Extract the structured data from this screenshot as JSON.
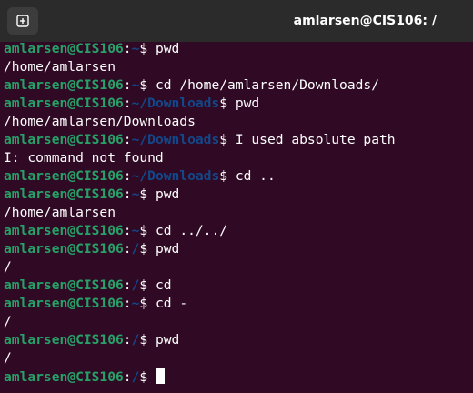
{
  "window": {
    "title": "amlarsen@CIS106: /"
  },
  "terminal": {
    "lines": [
      {
        "type": "prompt",
        "user": "amlarsen@CIS106",
        "path": "~",
        "command": "pwd"
      },
      {
        "type": "output",
        "text": "/home/amlarsen"
      },
      {
        "type": "prompt",
        "user": "amlarsen@CIS106",
        "path": "~",
        "command": "cd /home/amlarsen/Downloads/"
      },
      {
        "type": "prompt",
        "user": "amlarsen@CIS106",
        "path": "~/Downloads",
        "command": "pwd"
      },
      {
        "type": "output",
        "text": "/home/amlarsen/Downloads"
      },
      {
        "type": "prompt",
        "user": "amlarsen@CIS106",
        "path": "~/Downloads",
        "command": "I used absolute path"
      },
      {
        "type": "output",
        "text": "I: command not found"
      },
      {
        "type": "prompt",
        "user": "amlarsen@CIS106",
        "path": "~/Downloads",
        "command": "cd .."
      },
      {
        "type": "prompt",
        "user": "amlarsen@CIS106",
        "path": "~",
        "command": "pwd"
      },
      {
        "type": "output",
        "text": "/home/amlarsen"
      },
      {
        "type": "prompt",
        "user": "amlarsen@CIS106",
        "path": "~",
        "command": "cd ../../"
      },
      {
        "type": "prompt",
        "user": "amlarsen@CIS106",
        "path": "/",
        "command": "pwd"
      },
      {
        "type": "output",
        "text": "/"
      },
      {
        "type": "prompt",
        "user": "amlarsen@CIS106",
        "path": "/",
        "command": "cd"
      },
      {
        "type": "prompt",
        "user": "amlarsen@CIS106",
        "path": "~",
        "command": "cd -"
      },
      {
        "type": "output",
        "text": "/"
      },
      {
        "type": "prompt",
        "user": "amlarsen@CIS106",
        "path": "/",
        "command": "pwd"
      },
      {
        "type": "output",
        "text": "/"
      },
      {
        "type": "prompt",
        "user": "amlarsen@CIS106",
        "path": "/",
        "command": ""
      }
    ],
    "colors": {
      "background": "#300a24",
      "user": "#26a269",
      "path": "#12488b",
      "text": "#ffffff"
    }
  },
  "icons": {
    "new_tab": "new-tab-icon"
  }
}
